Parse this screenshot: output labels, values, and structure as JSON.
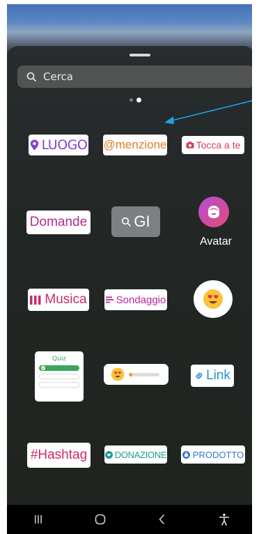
{
  "search": {
    "placeholder": "Cerca"
  },
  "stickers": {
    "luogo": "LUOGO",
    "menzione": "@menzione",
    "tocca_a_te": "Tocca a te",
    "domande": "Domande",
    "gif": "GI",
    "avatar": "Avatar",
    "musica": "Musica",
    "sondaggio": "Sondaggio",
    "quiz_title": "Quiz",
    "link": "Link",
    "hashtag": "#Hashtag",
    "donazione": "DONAZIONE",
    "prodotto": "PRODOTTO"
  },
  "page_indicator": {
    "pages": 2,
    "active": 2
  },
  "colors": {
    "luogo": "#8243d6",
    "menzione": "#e07d2a",
    "tocca_a_te": "#d93b5a",
    "domande": "#b62d8a",
    "musica": "#c72c6b",
    "sondaggio": "#b4289a",
    "link": "#2b8fd6",
    "hashtag": "#d1295e",
    "donazione": "#1f9e8e",
    "prodotto": "#3a74c8",
    "annotation_arrow": "#1aa3e8"
  },
  "navbar": {
    "icons": [
      "recent-apps-icon",
      "home-icon",
      "back-icon",
      "accessibility-icon"
    ]
  }
}
